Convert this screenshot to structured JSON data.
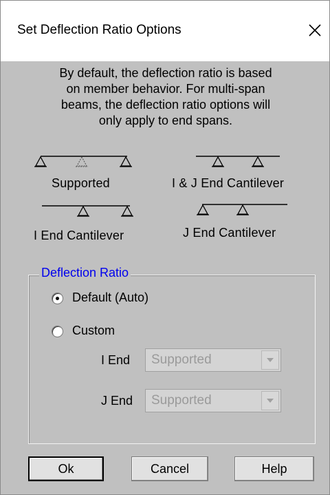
{
  "window": {
    "title": "Set Deflection Ratio Options",
    "close_glyph": "✕"
  },
  "description": {
    "lines": [
      "By default, the deflection ratio is based",
      "on member behavior. For multi-span",
      "beams, the deflection ratio options will",
      "only apply to end spans."
    ]
  },
  "diagrams": {
    "supported": "Supported",
    "ij_end_cantilever": "I & J End Cantilever",
    "i_end_cantilever": "I End Cantilever",
    "j_end_cantilever": "J End Cantilever"
  },
  "deflection_ratio": {
    "group_title": "Deflection Ratio",
    "option_default": "Default (Auto)",
    "option_custom": "Custom",
    "selected": "Default (Auto)",
    "i_end_label": "I End",
    "i_end_value": "Supported",
    "j_end_label": "J End",
    "j_end_value": "Supported"
  },
  "buttons": {
    "ok": "Ok",
    "cancel": "Cancel",
    "help": "Help"
  },
  "icons": {
    "close": "close-icon",
    "dropdown": "chevron-down-icon",
    "support": "triangle-support-icon"
  }
}
